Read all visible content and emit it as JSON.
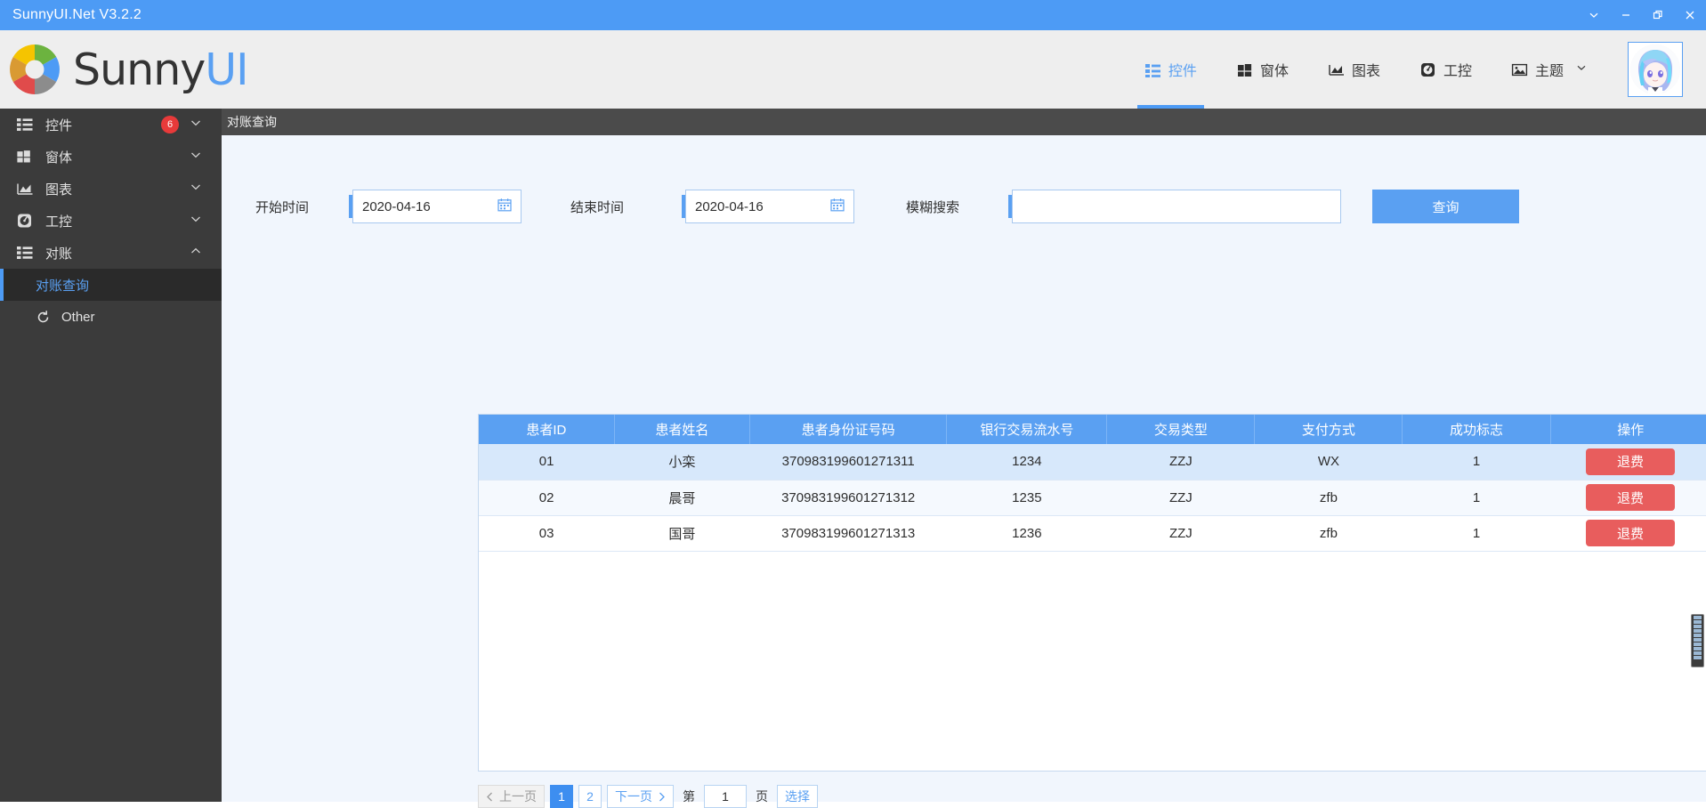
{
  "window": {
    "title": "SunnyUI.Net V3.2.2",
    "controls": [
      {
        "name": "chevron-down-icon",
        "label": ""
      },
      {
        "name": "minimize-icon",
        "label": ""
      },
      {
        "name": "restore-icon",
        "label": ""
      },
      {
        "name": "close-icon",
        "label": ""
      }
    ]
  },
  "brand": {
    "text_dark": "Sunny",
    "text_blue": "UI",
    "logo_icon": "pie-chart-logo"
  },
  "topnav": {
    "items": [
      {
        "label": "控件",
        "icon": "list-icon",
        "active": true
      },
      {
        "label": "窗体",
        "icon": "windows-icon",
        "active": false
      },
      {
        "label": "图表",
        "icon": "chart-icon",
        "active": false
      },
      {
        "label": "工控",
        "icon": "gauge-icon",
        "active": false
      },
      {
        "label": "主题",
        "icon": "image-icon",
        "active": false,
        "chevron": "▾"
      }
    ]
  },
  "sidebar": {
    "items": [
      {
        "label": "控件",
        "icon": "list-icon",
        "badge": "6",
        "chevron": "⌄"
      },
      {
        "label": "窗体",
        "icon": "windows-icon",
        "badge": "",
        "chevron": "⌄"
      },
      {
        "label": "图表",
        "icon": "chart-icon",
        "badge": "",
        "chevron": "⌄"
      },
      {
        "label": "工控",
        "icon": "gauge-icon",
        "badge": "",
        "chevron": "⌄"
      },
      {
        "label": "对账",
        "icon": "list-icon",
        "badge": "",
        "chevron": "⌃"
      }
    ],
    "subitems": [
      {
        "label": "对账查询",
        "icon": "",
        "selected": true
      },
      {
        "label": "Other",
        "icon": "refresh-icon",
        "selected": false
      }
    ]
  },
  "tabstrip": {
    "active_tab": "对账查询"
  },
  "filters": {
    "start_label": "开始时间",
    "start_value": "2020-04-16",
    "end_label": "结束时间",
    "end_value": "2020-04-16",
    "search_label": "模糊搜索",
    "search_value": "",
    "search_placeholder": "",
    "query_button": "查询",
    "calendar_icon": "calendar-icon"
  },
  "table": {
    "headers": [
      "患者ID",
      "患者姓名",
      "患者身份证号码",
      "银行交易流水号",
      "交易类型",
      "支付方式",
      "成功标志",
      "操作"
    ],
    "rows": [
      {
        "id": "01",
        "name": "小栾",
        "idcard": "370983199601271311",
        "serial": "1234",
        "type": "ZZJ",
        "pay": "WX",
        "flag": "1",
        "action": "退费"
      },
      {
        "id": "02",
        "name": "晨哥",
        "idcard": "370983199601271312",
        "serial": "1235",
        "type": "ZZJ",
        "pay": "zfb",
        "flag": "1",
        "action": "退费"
      },
      {
        "id": "03",
        "name": "国哥",
        "idcard": "370983199601271313",
        "serial": "1236",
        "type": "ZZJ",
        "pay": "zfb",
        "flag": "1",
        "action": "退费"
      }
    ]
  },
  "pager": {
    "prev": "上一页",
    "pages": [
      "1",
      "2"
    ],
    "active_page": "1",
    "next": "下一页",
    "goto_prefix": "第",
    "goto_value": "1",
    "goto_suffix": "页",
    "select_button": "选择"
  },
  "colors": {
    "accent": "#4d9bf5",
    "header_blue": "#5aa0f2",
    "sidebar_dark": "#3b3b3b",
    "content_bg": "#f1f6fd",
    "danger": "#e85d5d",
    "badge_red": "#e83a3a"
  }
}
